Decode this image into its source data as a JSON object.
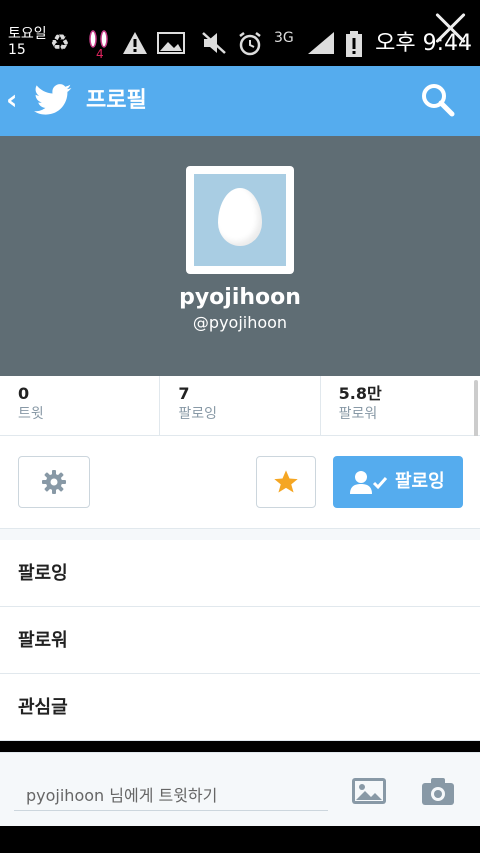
{
  "status_bar": {
    "date_line1": "토요일",
    "date_line2": "15",
    "network": "3G",
    "time": "오후 9:44",
    "icons": [
      "recycle-icon",
      "bunny-notification-icon",
      "warning-icon",
      "image-icon",
      "mute-icon",
      "alarm-icon",
      "network-3g-icon",
      "signal-icon",
      "battery-alert-icon"
    ],
    "bunny_badge": "4"
  },
  "app_bar": {
    "title": "프로필",
    "back_icon": "chevron-left-icon",
    "logo": "twitter-bird-icon",
    "search_icon": "search-icon"
  },
  "profile": {
    "name": "pyojihoon",
    "handle": "@pyojihoon"
  },
  "stats": [
    {
      "value": "0",
      "label": "트윗"
    },
    {
      "value": "7",
      "label": "팔로잉"
    },
    {
      "value": "5.8만",
      "label": "팔로워"
    }
  ],
  "actions": {
    "follow_label": "팔로잉"
  },
  "menu": [
    {
      "label": "팔로잉"
    },
    {
      "label": "팔로워"
    },
    {
      "label": "관심글"
    }
  ],
  "compose": {
    "placeholder": "pyojihoon 님에게 트윗하기"
  },
  "colors": {
    "twitter_blue": "#55acee",
    "header_gray": "#5f6d74",
    "star_orange": "#f5a623",
    "avatar_bg": "#a9cde3"
  }
}
